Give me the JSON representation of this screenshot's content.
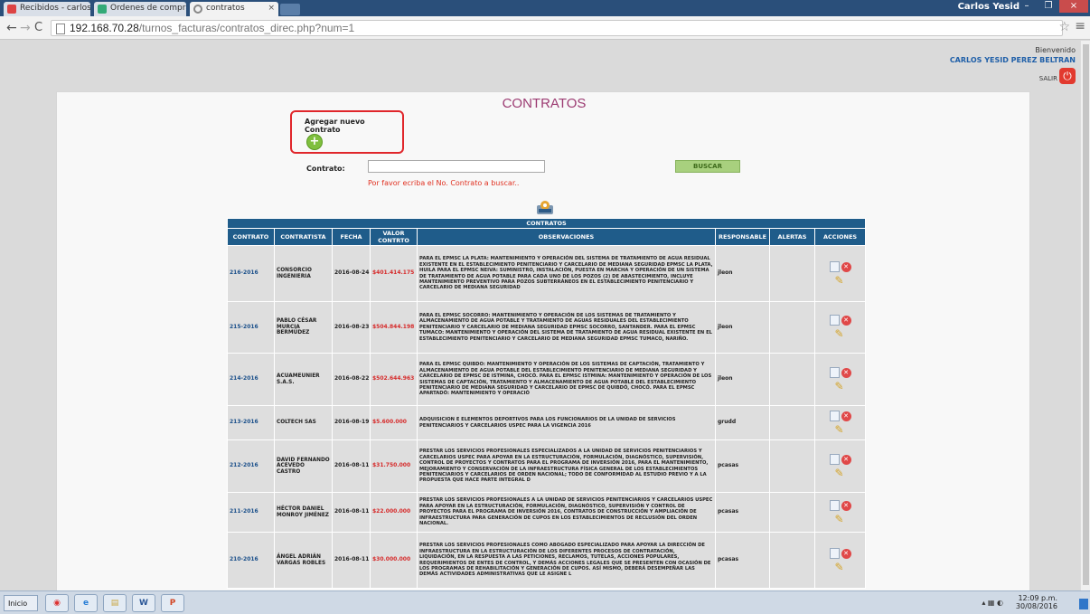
{
  "browser": {
    "tabs": [
      {
        "label": "Recibidos - carlos.perez@u...",
        "icon": "gmail-icon"
      },
      {
        "label": "Ordenes de compra | Colom...",
        "icon": "cart-icon"
      },
      {
        "label": "contratos",
        "icon": "loading-icon"
      }
    ],
    "user": "Carlos Yesid",
    "url_host": "192.168.70.28",
    "url_path": "/turnos_facturas/contratos_direc.php?num=1"
  },
  "header": {
    "welcome": "Bienvenido",
    "username": "CARLOS YESID PEREZ BELTRAN",
    "logout": "SALIR"
  },
  "page": {
    "title": "CONTRATOS",
    "add_label": "Agregar nuevo Contrato",
    "contract_label": "Contrato:",
    "contract_value": "",
    "search_button": "BUSCAR",
    "hint": "Por favor ecriba el No. Contrato a buscar.."
  },
  "table": {
    "caption": "CONTRATOS",
    "headers": [
      "CONTRATO",
      "CONTRATISTA",
      "FECHA",
      "VALOR CONTRTO",
      "OBSERVACIONES",
      "RESPONSABLE",
      "ALERTAS",
      "ACCIONES"
    ],
    "rows": [
      {
        "contrato": "216-2016",
        "contratista": "CONSORCIO INGENIERIA",
        "fecha": "2016-08-24",
        "valor": "$401.414.175",
        "obs": "PARA EL EPMSC LA PLATA: MANTENIMIENTO Y OPERACIÓN DEL SISTEMA DE TRATAMIENTO DE AGUA RESIDUAL EXISTENTE EN EL ESTABLECIMIENTO PENITENCIARIO Y CARCELARIO DE MEDIANA SEGURIDAD EPMSC LA PLATA, HUILA PARA EL EPMSC NEIVA: SUMINISTRO, INSTALACIÓN, PUESTA EN MARCHA Y OPERACIÓN DE UN SISTEMA DE TRATAMIENTO DE AGUA POTABLE PARA CADA UNO DE LOS POZOS (2) DE ABASTECIMIENTO, INCLUYE MANTENIMIENTO PREVENTIVO PARA POZOS SUBTERRÁNEOS EN EL ESTABLECIMIENTO PENITENCIARIO Y CARCELARIO DE MEDIANA SEGURIDAD",
        "resp": "jleon",
        "alertas": ""
      },
      {
        "contrato": "215-2016",
        "contratista": "PABLO CÉSAR MURCIA BERMÚDEZ",
        "fecha": "2016-08-23",
        "valor": "$504.844.198",
        "obs": "PARA EL EPMSC SOCORRO: MANTENIMIENTO Y OPERACIÓN DE LOS SISTEMAS DE TRATAMIENTO Y ALMACENAMIENTO DE AGUA POTABLE Y TRATAMIENTO DE AGUAS RESIDUALES DEL ESTABLECIMIENTO PENITENCIARIO Y CARCELARIO DE MEDIANA SEGURIDAD EPMSC SOCORRO, SANTANDER. PARA EL EPMSC TUMACO: MANTENIMIENTO Y OPERACIÓN DEL SISTEMA DE TRATAMIENTO DE AGUA RESIDUAL EXISTENTE EN EL ESTABLECIMIENTO PENITENCIARIO Y CARCELARIO DE MEDIANA SEGURIDAD EPMSC TUMACO, NARIÑO.",
        "resp": "jleon",
        "alertas": ""
      },
      {
        "contrato": "214-2016",
        "contratista": "ACUAMEUNIER S.A.S.",
        "fecha": "2016-08-22",
        "valor": "$502.644.963",
        "obs": "PARA EL EPMSC QUIBDO: MANTENIMIENTO Y OPERACIÓN DE LOS SISTEMAS DE CAPTACIÓN, TRATAMIENTO Y ALMACENAMIENTO DE AGUA POTABLE DEL ESTABLECIMIENTO PENITENCIARIO DE MEDIANA SEGURIDAD Y CARCELARIO DE EPMSC DE ISTMINA, CHOCÓ. PARA EL EPMSC ISTMINA: MANTENIMIENTO Y OPERACIÓN DE LOS SISTEMAS DE CAPTACIÓN, TRATAMIENTO Y ALMACENAMIENTO DE AGUA POTABLE DEL ESTABLECIMIENTO PENITENCIARIO DE MEDIANA SEGURIDAD Y CARCELARIO DE EPMSC DE QUIBDÓ, CHOCÓ. PARA EL EPMSC APARTADÓ: MANTENIMIENTO Y OPERACIÓ",
        "resp": "jleon",
        "alertas": ""
      },
      {
        "contrato": "213-2016",
        "contratista": "COLTECH SAS",
        "fecha": "2016-08-19",
        "valor": "$5.600.000",
        "obs": "ADQUISICION E ELEMENTOS DEPORTIVOS PARA LOS FUNCIONARIOS DE LA UNIDAD DE SERVICIOS PENITENCIARIOS Y CARCELARIOS USPEC PARA LA VIGENCIA 2016",
        "resp": "grudd",
        "alertas": ""
      },
      {
        "contrato": "212-2016",
        "contratista": "DAVID FERNANDO ACEVEDO CASTRO",
        "fecha": "2016-08-11",
        "valor": "$31.750.000",
        "obs": "PRESTAR LOS SERVICIOS PROFESIONALES ESPECIALIZADOS A LA UNIDAD DE SERVICIOS PENITENCIARIOS Y CARCELARIOS USPEC PARA APOYAR EN LA ESTRUCTURACIÓN, FORMULACIÓN, DIAGNÓSTICO, SUPERVISIÓN, CONTROL DE PROYECTOS Y CONTRATOS PARA EL PROGRAMA DE INVERSIÓN 2016, PARA EL MANTENIMIENTO, MEJORAMIENTO Y CONSERVACIÓN DE LA INFRAESTRUCTURA FÍSICA GENERAL DE LOS ESTABLECIMIENTOS PENITENCIARIOS Y CARCELARIOS DE ORDEN NACIONAL; TODO DE CONFORMIDAD AL ESTUDIO PREVIO Y A LA PROPUESTA QUE HACE PARTE INTEGRAL D",
        "resp": "pcasas",
        "alertas": ""
      },
      {
        "contrato": "211-2016",
        "contratista": "HÉCTOR DANIEL MONROY JIMÉNEZ",
        "fecha": "2016-08-11",
        "valor": "$22.000.000",
        "obs": "PRESTAR LOS SERVICIOS PROFESIONALES A LA UNIDAD DE SERVICIOS PENITENCIARIOS Y CARCELARIOS USPEC PARA APOYAR EN LA ESTRUCTURACIÓN, FORMULACIÓN, DIAGNÓSTICO, SUPERVISIÓN Y CONTROL DE PROYECTOS PARA EL PROGRAMA DE INVERSIÓN 2016, CONTRATOS DE CONSTRUCCIÓN Y AMPLIACIÓN DE INFRAESTRUCTURA PARA GENERACIÓN DE CUPOS EN LOS ESTABLECIMIENTOS DE RECLUSIÓN DEL ORDEN NACIONAL.",
        "resp": "pcasas",
        "alertas": ""
      },
      {
        "contrato": "210-2016",
        "contratista": "ÁNGEL ADRIÁN VARGAS ROBLES",
        "fecha": "2016-08-11",
        "valor": "$30.000.000",
        "obs": "PRESTAR LOS SERVICIOS PROFESIONALES COMO ABOGADO ESPECIALIZADO PARA APOYAR LA DIRECCIÓN DE INFRAESTRUCTURA EN LA ESTRUCTURACIÓN DE LOS DIFERENTES PROCESOS DE CONTRATACIÓN, LIQUIDACIÓN, EN LA RESPUESTA A LAS PETICIONES, RECLAMOS, TUTELAS, ACCIONES POPULARES, REQUERIMIENTOS DE ENTES DE CONTROL, Y DEMÁS ACCIONES LEGALES QUE SE PRESENTEN CON OCASIÓN DE LOS PROGRAMAS DE REHABILITACIÓN Y GENERACIÓN DE CUPOS. ASÍ MISMO, DEBERÁ DESEMPEÑAR LAS DEMÁS ACTIVIDADES ADMINISTRATIVAS QUE LE ASIGNE L",
        "resp": "pcasas",
        "alertas": ""
      }
    ]
  },
  "taskbar": {
    "start": "Inicio",
    "time": "12:09 p.m.",
    "date": "30/08/2016"
  }
}
